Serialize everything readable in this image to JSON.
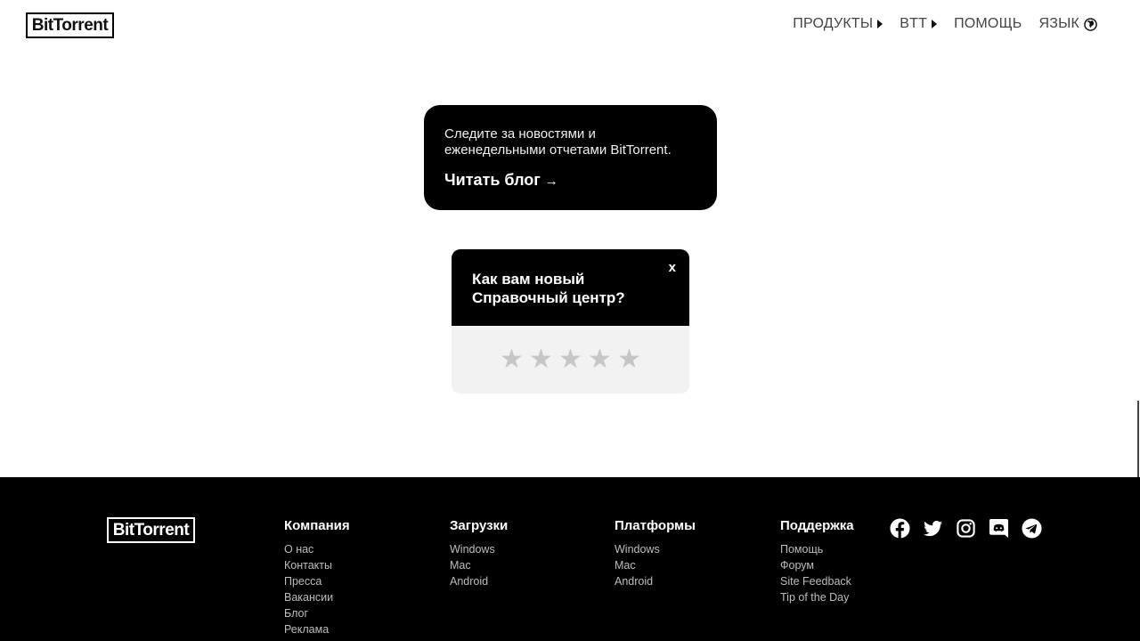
{
  "header": {
    "logo": "BitTorrent",
    "nav": [
      {
        "label": "ПРОДУКТЫ",
        "icon": "triangle-right-icon"
      },
      {
        "label": "BTT",
        "icon": "triangle-right-icon"
      },
      {
        "label": "ПОМОЩЬ"
      },
      {
        "label": "ЯЗЫК",
        "icon": "globe-icon"
      }
    ]
  },
  "blog_card": {
    "description": "Следите за новостями и еженедельными отчетами BitTorrent.",
    "link_label": "Читать блог",
    "arrow": "→"
  },
  "rating_widget": {
    "question_line1": "Как вам новый",
    "question_line2": "Справочный центр?",
    "close_label": "x",
    "stars": 5,
    "selected": 0,
    "star_glyph": "★"
  },
  "footer": {
    "logo": "BitTorrent",
    "columns": [
      {
        "title": "Компания",
        "links": [
          "О нас",
          "Контакты",
          "Пресса",
          "Вакансии",
          "Блог",
          "Реклама"
        ]
      },
      {
        "title": "Загрузки",
        "links": [
          "Windows",
          "Mac",
          "Android"
        ]
      },
      {
        "title": "Платформы",
        "links": [
          "Windows",
          "Mac",
          "Android"
        ]
      },
      {
        "title": "Поддержка",
        "links": [
          "Помощь",
          "Форум",
          "Site Feedback",
          "Tip of the Day"
        ]
      }
    ],
    "socials": [
      "facebook-icon",
      "twitter-icon",
      "instagram-icon",
      "discord-icon",
      "telegram-icon"
    ]
  },
  "colors": {
    "background": "#ffffff",
    "footer_bg": "#000000",
    "card_bg": "#000000",
    "star_empty": "#c6c6c6",
    "rating_bg": "#f2f2f2"
  }
}
